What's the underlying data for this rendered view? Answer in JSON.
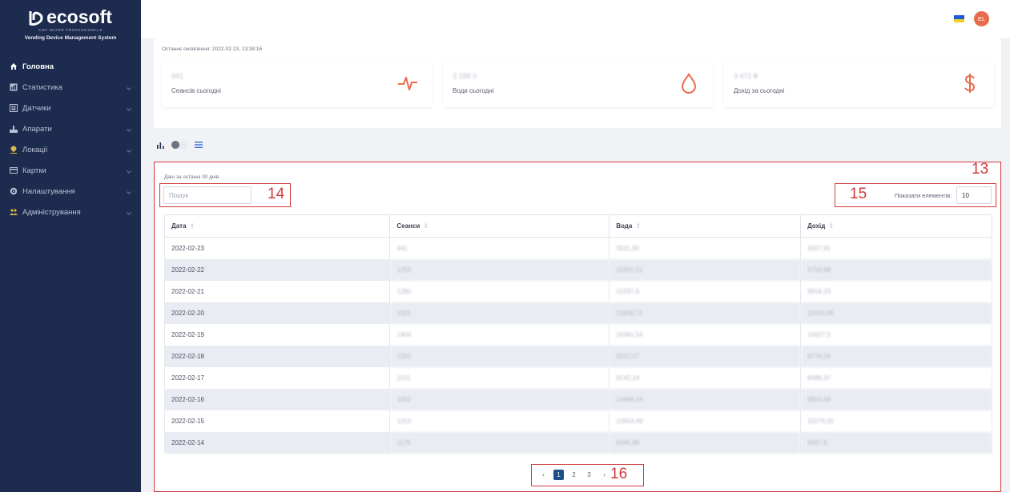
{
  "brand": {
    "name": "ecosoft",
    "tagline": "KWT WATER PROFESSIONALS",
    "subtitle": "Vending Device Management System"
  },
  "sidebar": {
    "items": [
      {
        "label": "Головна",
        "icon": "home-icon",
        "active": true
      },
      {
        "label": "Статистика",
        "icon": "chart-icon"
      },
      {
        "label": "Датчики",
        "icon": "sensor-icon"
      },
      {
        "label": "Апарати",
        "icon": "machine-icon"
      },
      {
        "label": "Локації",
        "icon": "location-pin-icon"
      },
      {
        "label": "Картки",
        "icon": "card-icon"
      },
      {
        "label": "Налаштування",
        "icon": "gear-icon"
      },
      {
        "label": "Адміністрування",
        "icon": "users-icon"
      }
    ]
  },
  "topbar": {
    "avatar_initials": "EL",
    "flag": "ukraine-flag-icon"
  },
  "summary": {
    "last_update": "Останнє оновлення: 2022-02-23, 13:38:16",
    "cards": [
      {
        "value": "441",
        "label": "Сеансів сьогодні",
        "icon": "pulse-icon"
      },
      {
        "value": "3 188 л",
        "label": "Води сьогодні",
        "icon": "water-drop-icon"
      },
      {
        "value": "3 472 ₴",
        "label": "Дохід за сьогодні",
        "icon": "dollar-icon"
      }
    ]
  },
  "panel": {
    "caption": "Дані за останні 30 днів",
    "search_placeholder": "Пошук",
    "show_label": "Показати елементів:",
    "show_value": "10",
    "markers": {
      "panel": "13",
      "search": "14",
      "show": "15",
      "pager": "16"
    },
    "columns": [
      "Дата",
      "Сеанси",
      "Вода",
      "Дохід"
    ],
    "rows": [
      [
        "2022-02-23",
        "441",
        "3331,90",
        "3007,91"
      ],
      [
        "2022-02-22",
        "1263",
        "10301,51",
        "9756,88"
      ],
      [
        "2022-02-21",
        "1280",
        "10297,6",
        "9916,33"
      ],
      [
        "2022-02-20",
        "1325",
        "11809,73",
        "10415,85"
      ],
      [
        "2022-02-19",
        "1404",
        "10381,54",
        "10027,5"
      ],
      [
        "2022-02-18",
        "1202",
        "9107,07",
        "8774,34"
      ],
      [
        "2022-02-17",
        "1011",
        "9142,14",
        "8086,37"
      ],
      [
        "2022-02-16",
        "1092",
        "10486,24",
        "9805,69"
      ],
      [
        "2022-02-15",
        "1310",
        "10954,69",
        "10276,91"
      ],
      [
        "2022-02-14",
        "1176",
        "8345,88",
        "9087,8"
      ]
    ],
    "pagination": {
      "prev": "‹",
      "pages": [
        "1",
        "2",
        "3"
      ],
      "next": "›",
      "current": "1"
    }
  },
  "colors": {
    "sidebar_bg": "#1d2b4f",
    "accent_orange": "#e96b4c",
    "highlight_red": "#d23a3a",
    "page_active": "#1d4f86"
  }
}
